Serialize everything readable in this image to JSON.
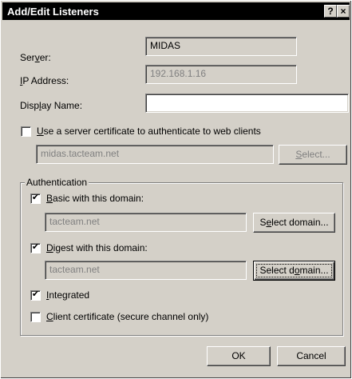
{
  "window": {
    "title": "Add/Edit Listeners",
    "help_glyph": "?",
    "close_glyph": "×"
  },
  "server": {
    "label_pre": "Ser",
    "label_u": "v",
    "label_post": "er:",
    "value": "MIDAS"
  },
  "ip": {
    "label_pre": "",
    "label_u": "I",
    "label_post": "P Address:",
    "value": "192.168.1.16"
  },
  "display_name": {
    "label_pre": "Disp",
    "label_u": "l",
    "label_post": "ay Name:",
    "value": ""
  },
  "cert": {
    "checked": false,
    "label_pre": "",
    "label_u": "U",
    "label_post": "se a server certificate to authenticate to web clients",
    "value": "midas.tacteam.net",
    "select_pre": "",
    "select_u": "S",
    "select_post": "elect..."
  },
  "auth": {
    "group_title": "Authentication",
    "basic": {
      "checked": true,
      "label_pre": "",
      "label_u": "B",
      "label_post": "asic with this domain:",
      "value": "tacteam.net",
      "select_pre": "S",
      "select_u": "e",
      "select_post": "lect domain..."
    },
    "digest": {
      "checked": true,
      "label_pre": "",
      "label_u": "D",
      "label_post": "igest with this domain:",
      "value": "tacteam.net",
      "select_pre": "Select d",
      "select_u": "o",
      "select_post": "main..."
    },
    "integrated": {
      "checked": true,
      "label_pre": "",
      "label_u": "I",
      "label_post": "ntegrated"
    },
    "client_cert": {
      "checked": false,
      "label_pre": "",
      "label_u": "C",
      "label_post": "lient certificate (secure channel only)"
    }
  },
  "buttons": {
    "ok": "OK",
    "cancel": "Cancel"
  },
  "checkmark": "✔"
}
